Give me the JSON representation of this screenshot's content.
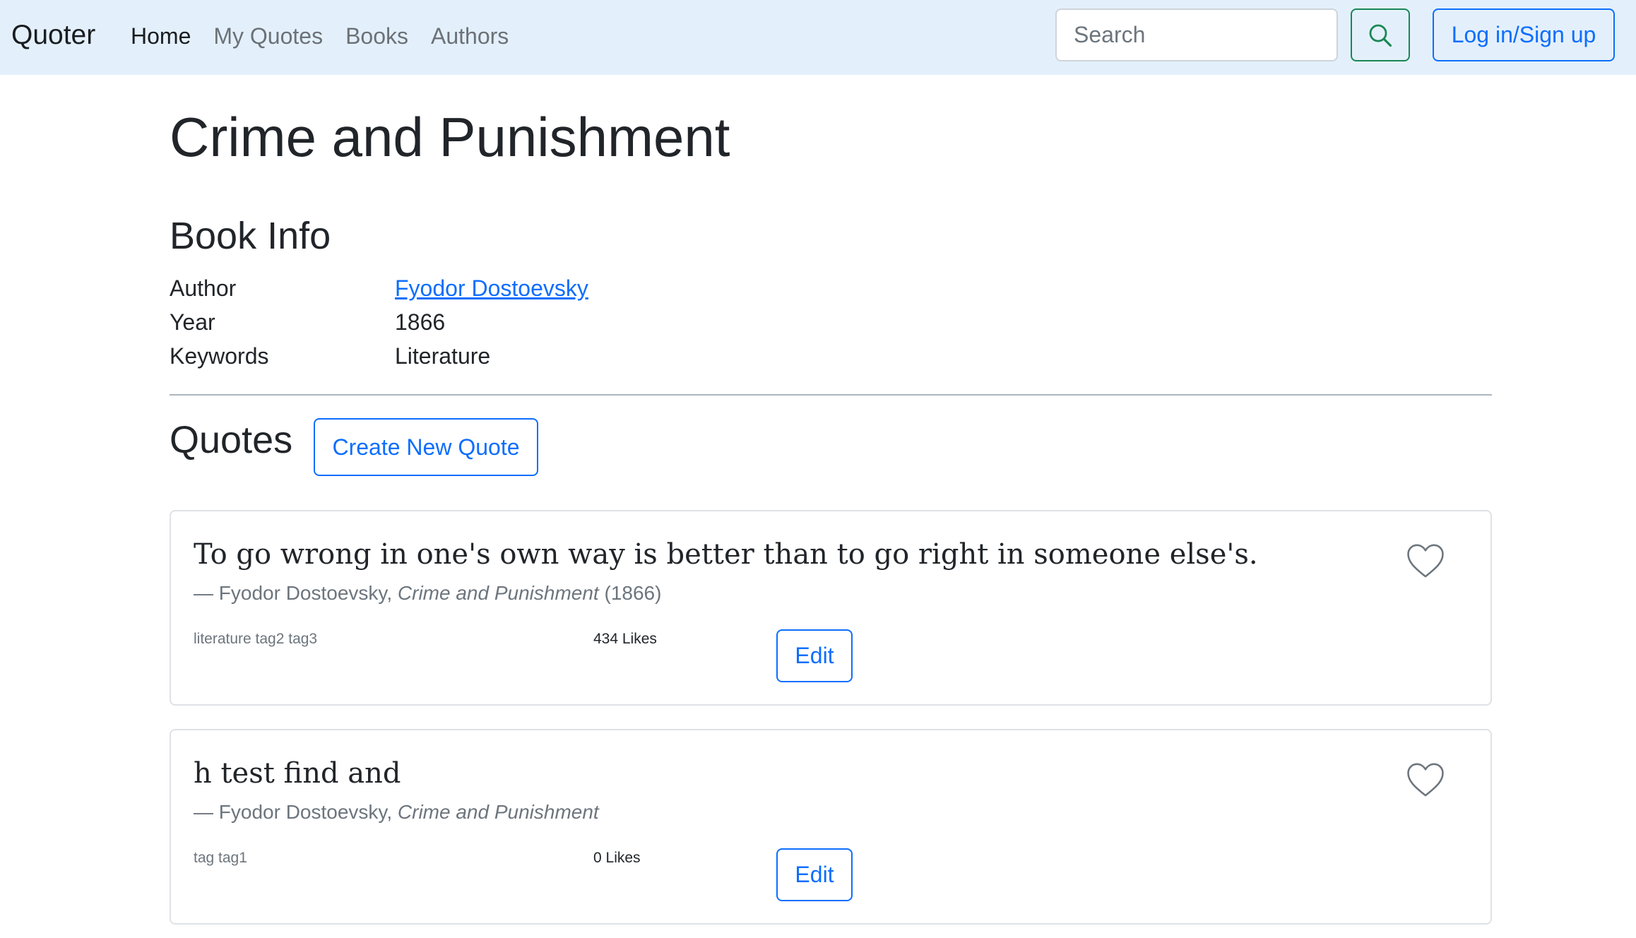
{
  "navbar": {
    "brand": "Quoter",
    "links": [
      {
        "label": "Home",
        "active": true
      },
      {
        "label": "My Quotes",
        "active": false
      },
      {
        "label": "Books",
        "active": false
      },
      {
        "label": "Authors",
        "active": false
      }
    ],
    "search_placeholder": "Search",
    "search_icon": "search-icon",
    "login_label": "Log in/Sign up"
  },
  "book": {
    "title": "Crime and Punishment",
    "info_heading": "Book Info",
    "info": [
      {
        "label": "Author",
        "value": "Fyodor Dostoevsky"
      },
      {
        "label": "Year",
        "value": "1866"
      },
      {
        "label": "Keywords",
        "value": "Literature"
      }
    ]
  },
  "quotes_section": {
    "heading": "Quotes",
    "create_label": "Create New Quote",
    "quotes": [
      {
        "text": "To go wrong in one's own way is better than to go right in someone else's.",
        "source_prefix": "— Fyodor Dostoevsky, ",
        "source_book": "Crime and Punishment",
        "source_year": " (1866)",
        "tags": "literature tag2 tag3",
        "likes": "434 Likes",
        "edit_label": "Edit",
        "like_icon": "heart-outline-icon"
      },
      {
        "text": "h test find and",
        "source_prefix": "— Fyodor Dostoevsky, ",
        "source_book": "Crime and Punishment",
        "source_year": "",
        "tags": "tag tag1",
        "likes": "0 Likes",
        "edit_label": "Edit",
        "like_icon": "heart-outline-icon"
      }
    ]
  },
  "colors": {
    "navbar_bg": "#e3f0fb",
    "primary": "#0d6efd",
    "success": "#198754",
    "muted": "#6c757d"
  }
}
